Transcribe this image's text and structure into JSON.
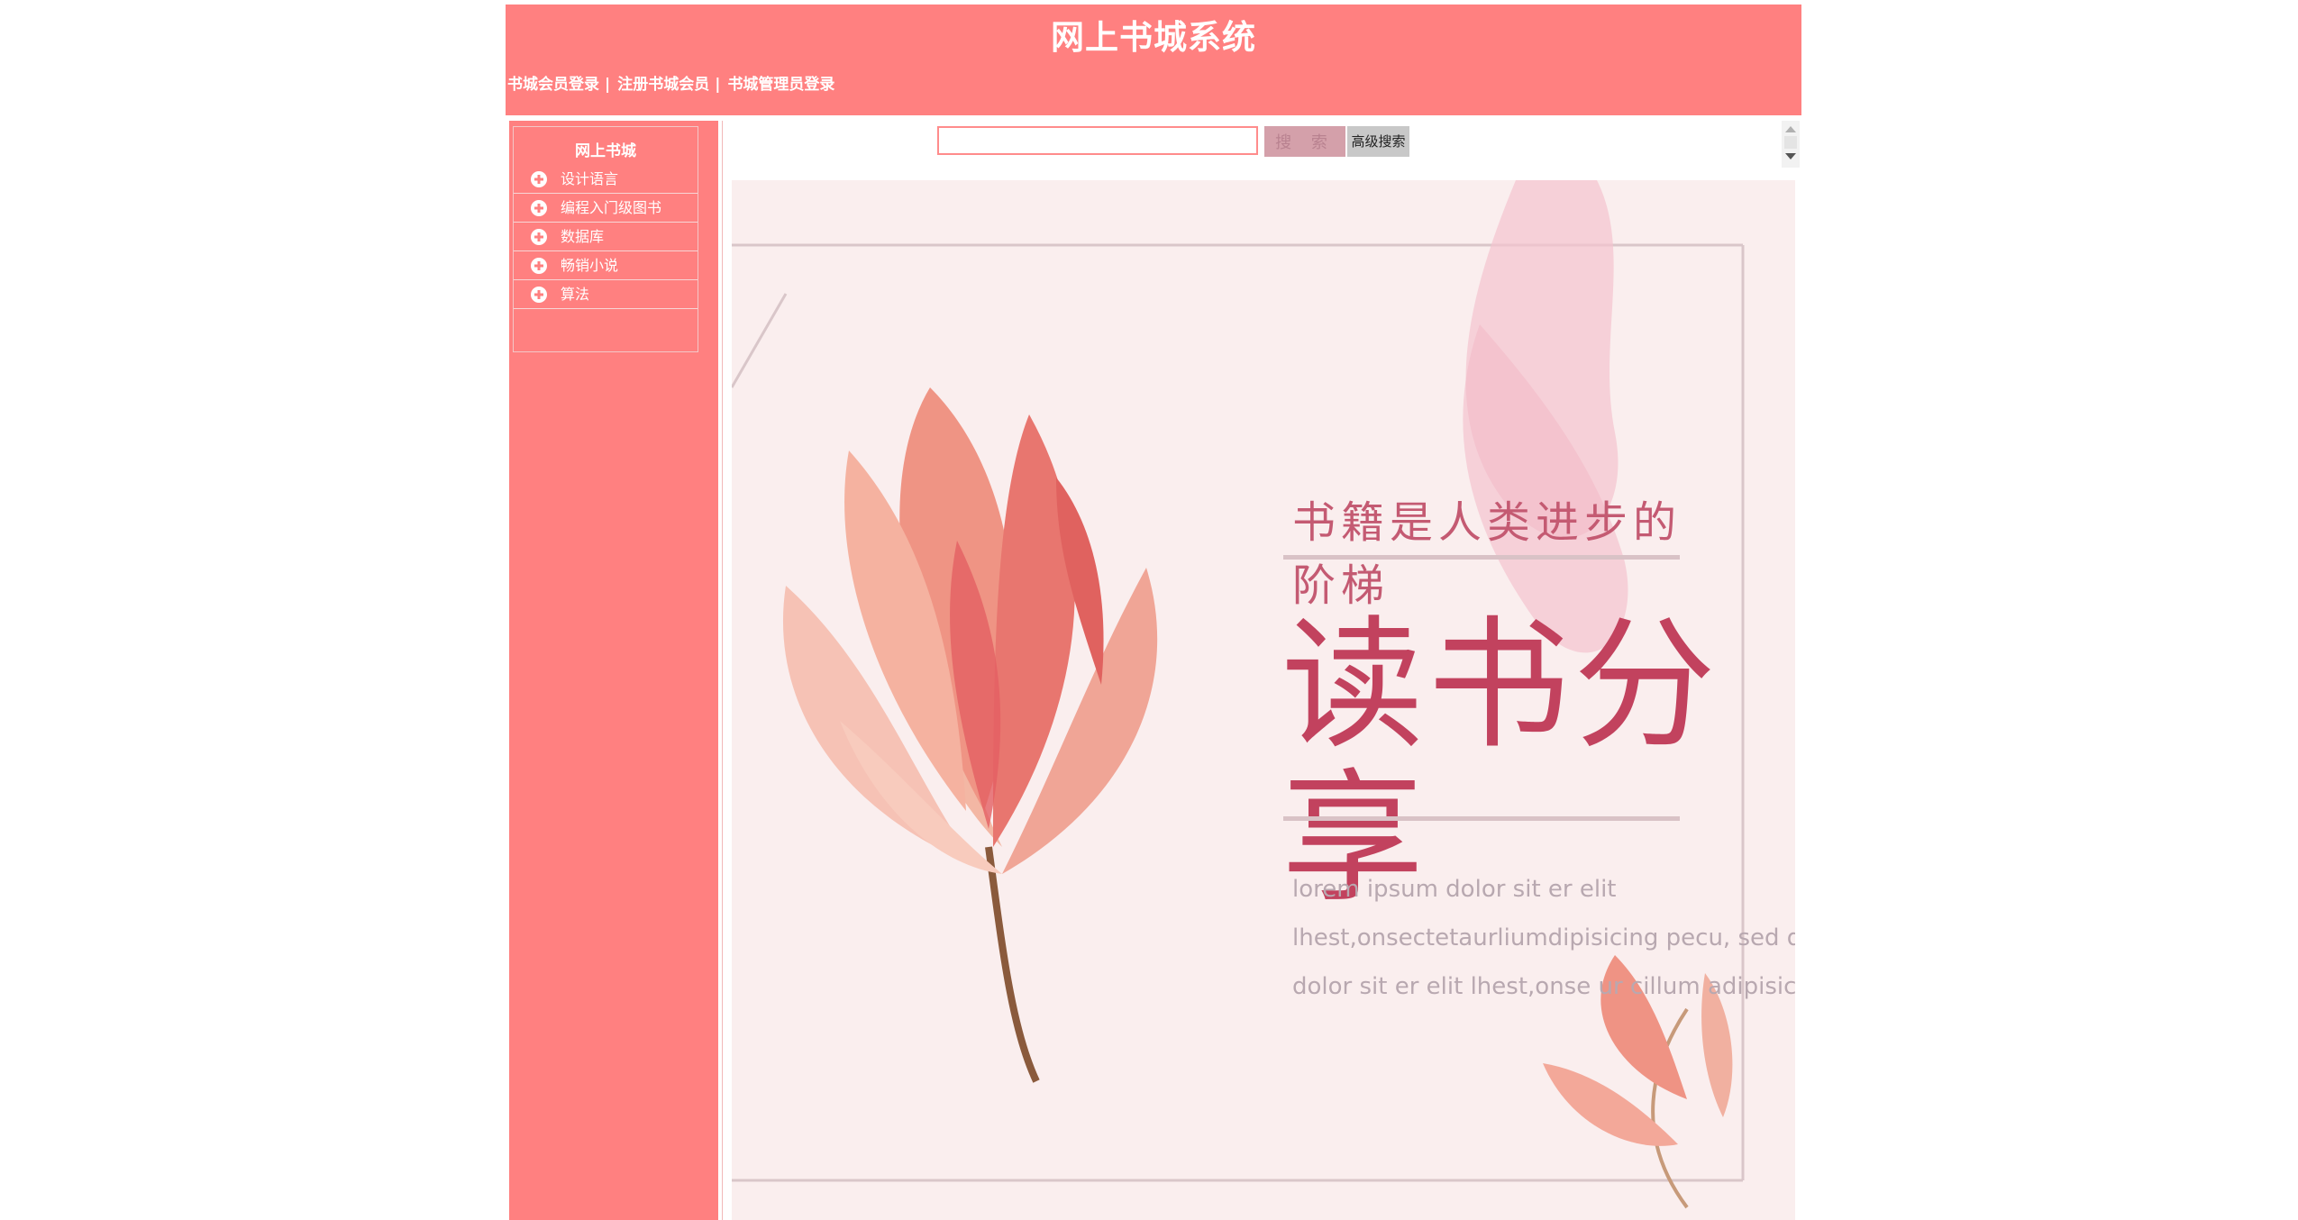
{
  "header": {
    "title": "网上书城系统",
    "nav": [
      {
        "label": "书城会员登录"
      },
      {
        "label": "注册书城会员"
      },
      {
        "label": "书城管理员登录"
      }
    ],
    "separator": "|",
    "color": "#ff8080"
  },
  "sidebar": {
    "title": "网上书城",
    "items": [
      {
        "label": "设计语言",
        "icon": "plus-circle-icon"
      },
      {
        "label": "编程入门级图书",
        "icon": "plus-circle-icon"
      },
      {
        "label": "数据库",
        "icon": "plus-circle-icon"
      },
      {
        "label": "畅销小说",
        "icon": "plus-circle-icon"
      },
      {
        "label": "算法",
        "icon": "plus-circle-icon"
      }
    ]
  },
  "search": {
    "value": "",
    "button_label": "搜 索",
    "advanced_label": "高级搜索"
  },
  "banner": {
    "heading": "书籍是人类进步的阶梯",
    "title": "读书分享",
    "lorem": [
      "lorem ipsum dolor sit er elit",
      "lhest,onsectetaurliumdipisicing pecu, sed do eius",
      "dolor sit er elit lhest,onse ur cillum adipisicing"
    ],
    "accent": "#c2425e"
  }
}
